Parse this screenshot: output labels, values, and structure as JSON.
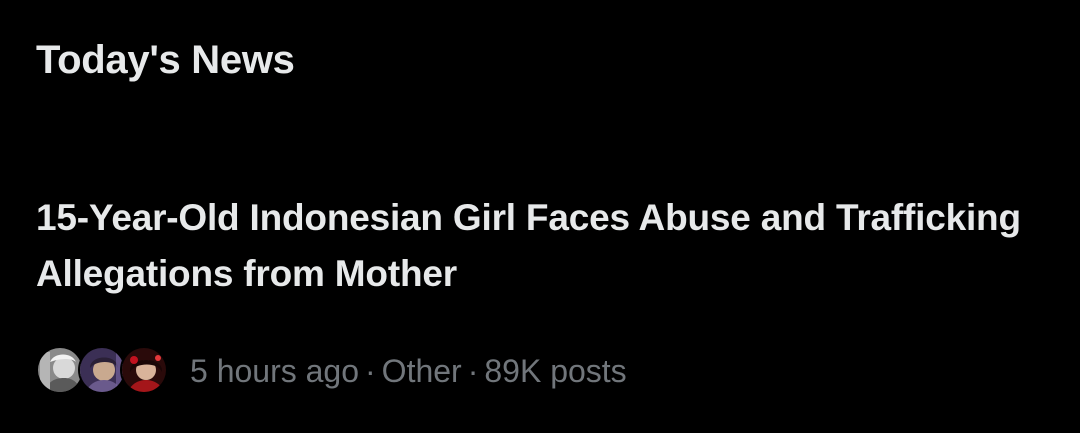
{
  "section": {
    "title": "Today's News"
  },
  "story": {
    "headline": "15-Year-Old Indonesian Girl Faces Abuse and Trafficking Allegations from Mother",
    "time_ago": "5 hours ago",
    "separator": "·",
    "category": "Other",
    "post_count": "89K posts",
    "avatars": [
      {
        "icon": "avatar-portrait-grayscale"
      },
      {
        "icon": "avatar-portrait-purple"
      },
      {
        "icon": "avatar-portrait-red"
      }
    ]
  },
  "colors": {
    "background": "#000000",
    "primary_text": "#e7e9ea",
    "secondary_text": "#71767b"
  }
}
